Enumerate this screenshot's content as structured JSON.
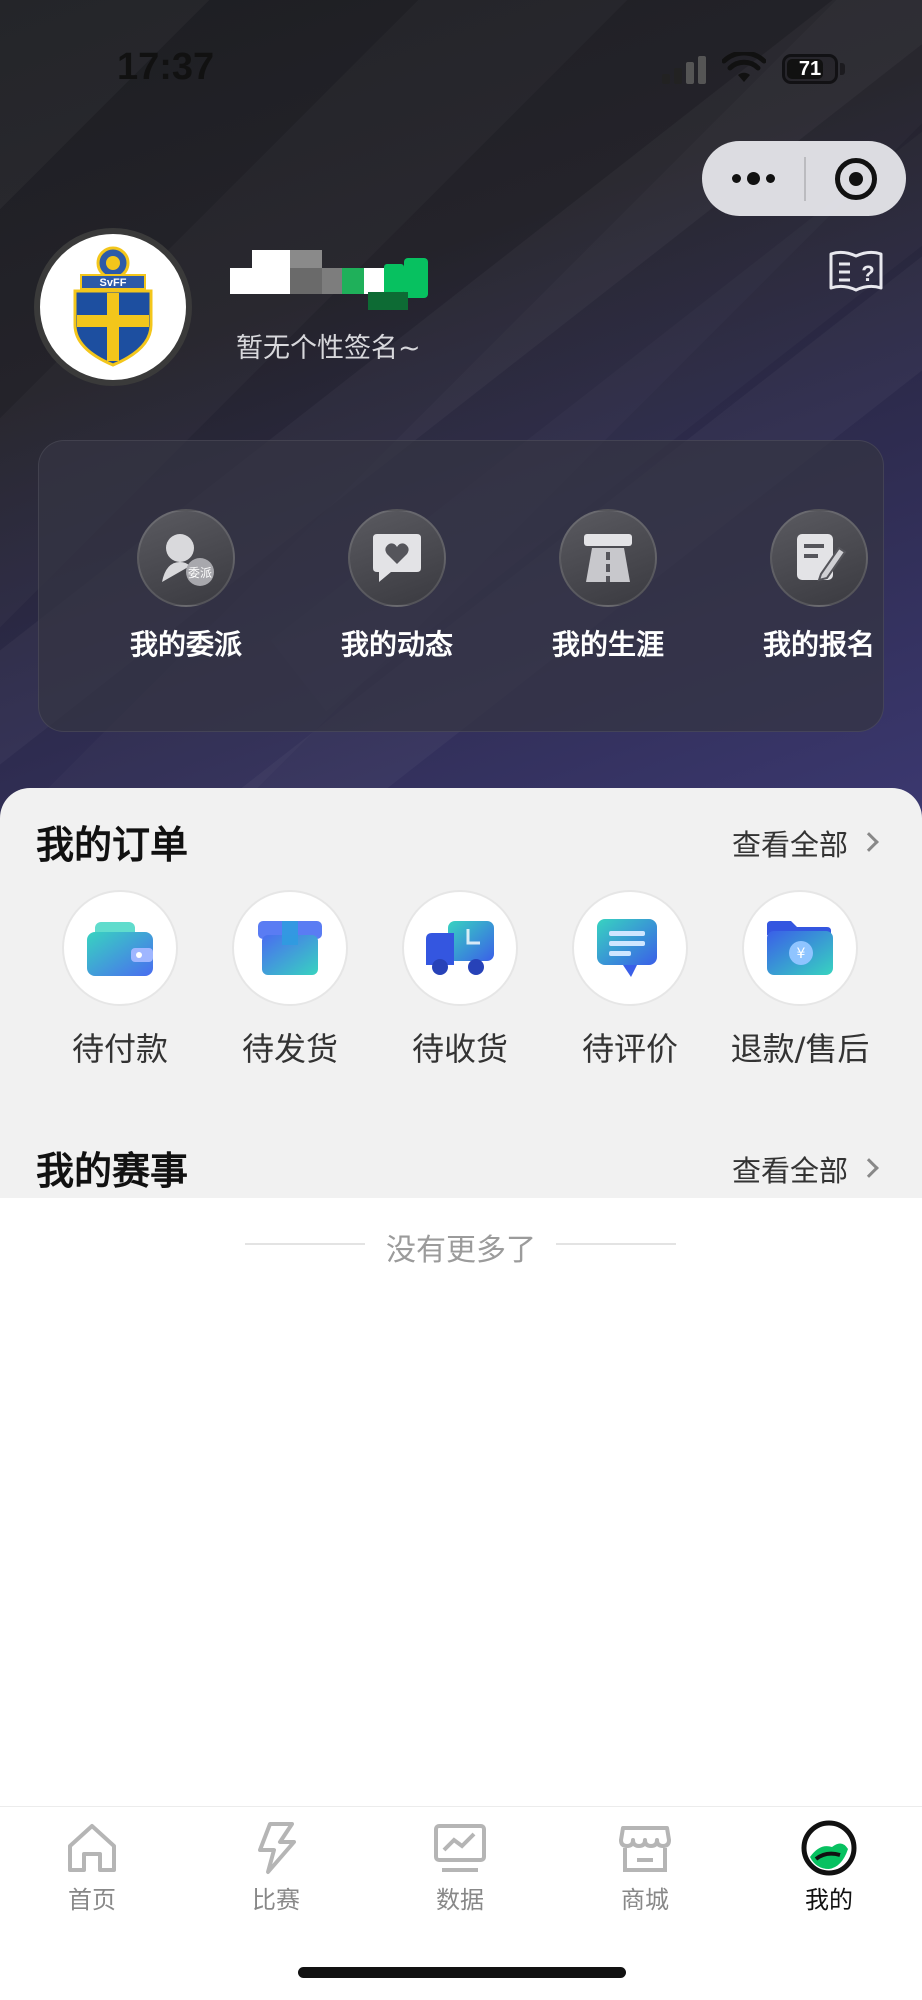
{
  "status_bar": {
    "time": "17:37",
    "battery": "71"
  },
  "capsule": {
    "more_icon": "more-dots-icon",
    "close_icon": "target-close-icon"
  },
  "profile": {
    "signature": "暂无个性签名~",
    "avatar_logo_text": "SvFF"
  },
  "quick_menu": [
    {
      "label": "我的委派",
      "icon": "user-assign-icon"
    },
    {
      "label": "我的动态",
      "icon": "heart-message-icon"
    },
    {
      "label": "我的生涯",
      "icon": "road-icon"
    },
    {
      "label": "我的报名",
      "icon": "edit-form-icon"
    }
  ],
  "orders": {
    "title": "我的订单",
    "view_all": "查看全部",
    "items": [
      {
        "label": "待付款",
        "icon": "wallet-icon"
      },
      {
        "label": "待发货",
        "icon": "package-icon"
      },
      {
        "label": "待收货",
        "icon": "delivery-truck-icon"
      },
      {
        "label": "待评价",
        "icon": "comment-icon"
      },
      {
        "label": "退款/售后",
        "icon": "refund-folder-icon"
      }
    ]
  },
  "events": {
    "title": "我的赛事",
    "view_all": "查看全部",
    "empty_text": "没有更多了"
  },
  "tabbar": [
    {
      "label": "首页",
      "icon": "home-icon",
      "active": false
    },
    {
      "label": "比赛",
      "icon": "lightning-icon",
      "active": false
    },
    {
      "label": "数据",
      "icon": "chart-monitor-icon",
      "active": false
    },
    {
      "label": "商城",
      "icon": "store-icon",
      "active": false
    },
    {
      "label": "我的",
      "icon": "profile-avatar-icon",
      "active": true
    }
  ],
  "colors": {
    "accent_green": "#07c160",
    "order_icon_blue": "#4a6cf0",
    "order_icon_teal": "#38d3c0"
  }
}
